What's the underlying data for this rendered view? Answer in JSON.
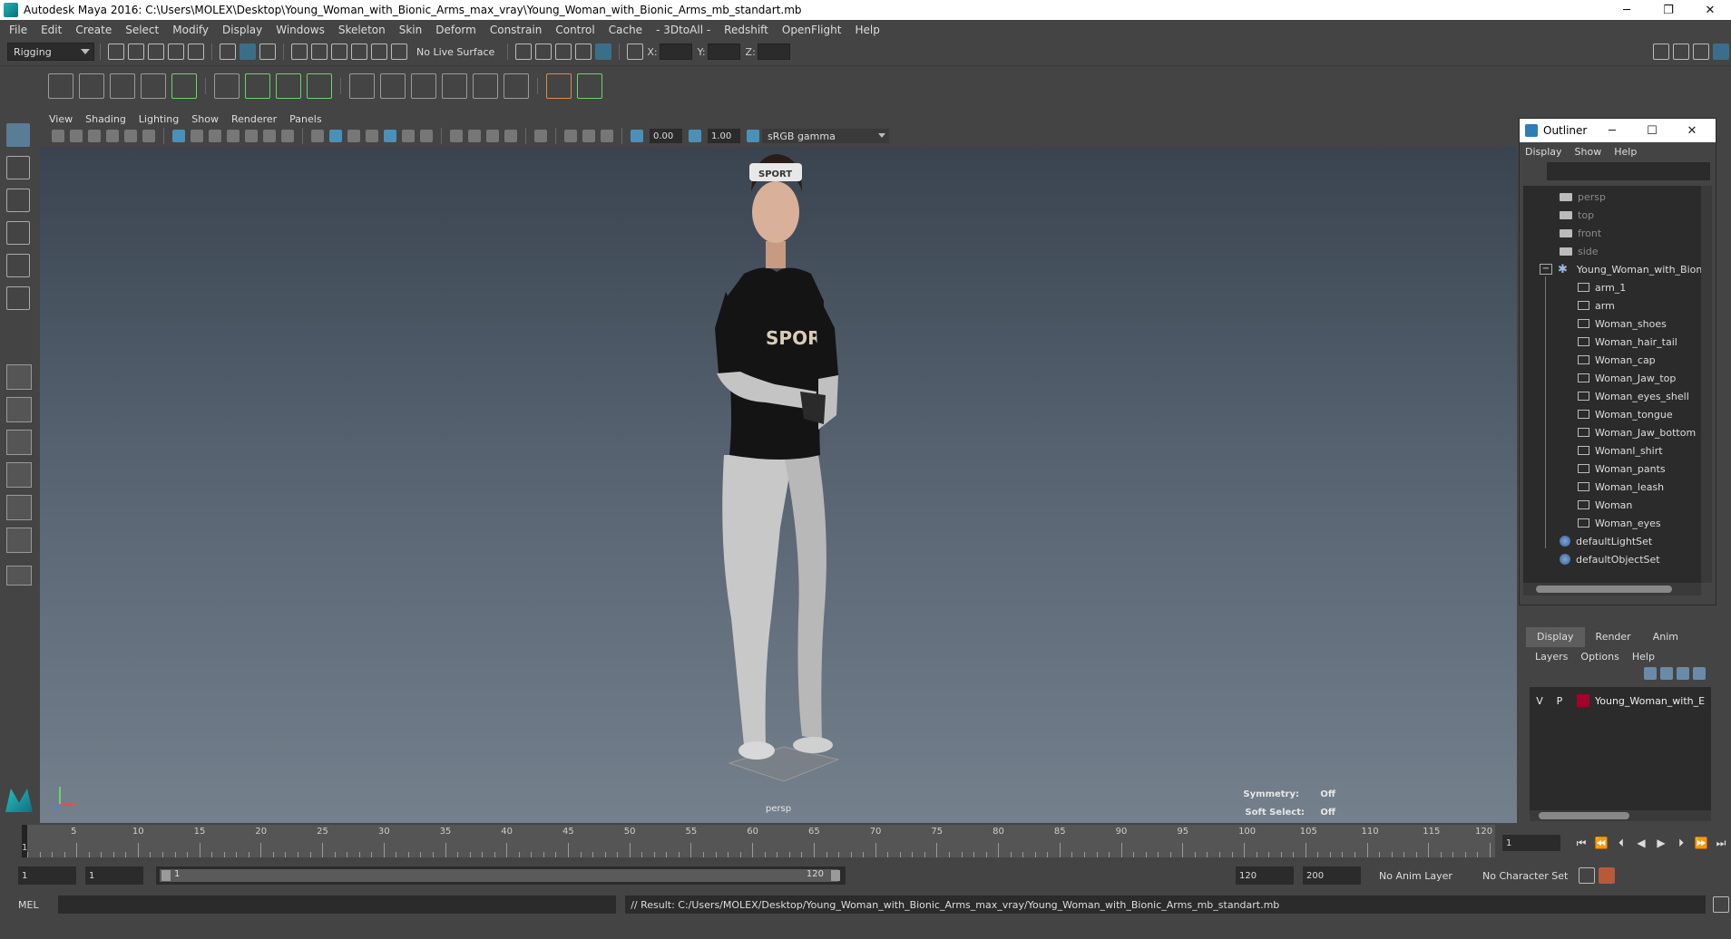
{
  "window": {
    "title": "Autodesk Maya 2016: C:\\Users\\MOLEX\\Desktop\\Young_Woman_with_Bionic_Arms_max_vray\\Young_Woman_with_Bionic_Arms_mb_standart.mb",
    "minimize": "─",
    "restore": "❐",
    "close": "✕"
  },
  "menubar": [
    "File",
    "Edit",
    "Create",
    "Select",
    "Modify",
    "Display",
    "Windows",
    "Skeleton",
    "Skin",
    "Deform",
    "Constrain",
    "Control",
    "Cache",
    "- 3DtoAll -",
    "Redshift",
    "OpenFlight",
    "Help"
  ],
  "statusline": {
    "menu_set": "Rigging",
    "live_surface": "No Live Surface",
    "x_label": "X:",
    "y_label": "Y:",
    "z_label": "Z:"
  },
  "viewport": {
    "menu": [
      "View",
      "Shading",
      "Lighting",
      "Show",
      "Renderer",
      "Panels"
    ],
    "field1": "0.00",
    "field2": "1.00",
    "colorspace": "sRGB gamma",
    "camera_label": "persp",
    "symmetry_label": "Symmetry:",
    "symmetry_value": "Off",
    "soft_select_label": "Soft Select:",
    "soft_select_value": "Off",
    "character_shirt_text": "SPORT",
    "character_cap_text": "SPORT"
  },
  "outliner": {
    "title": "Outliner",
    "menu": [
      "Display",
      "Show",
      "Help"
    ],
    "items": [
      {
        "label": "persp",
        "icon": "camera-icon",
        "dim": true
      },
      {
        "label": "top",
        "icon": "camera-icon",
        "dim": true
      },
      {
        "label": "front",
        "icon": "camera-icon",
        "dim": true
      },
      {
        "label": "side",
        "icon": "camera-icon",
        "dim": true
      },
      {
        "label": "Young_Woman_with_Bioni",
        "icon": "group-icon",
        "expanded": "−"
      },
      {
        "label": "arm_1",
        "icon": "mesh-icon"
      },
      {
        "label": "arm",
        "icon": "mesh-icon"
      },
      {
        "label": "Woman_shoes",
        "icon": "mesh-icon"
      },
      {
        "label": "Woman_hair_tail",
        "icon": "mesh-icon"
      },
      {
        "label": "Woman_cap",
        "icon": "mesh-icon"
      },
      {
        "label": "Woman_Jaw_top",
        "icon": "mesh-icon"
      },
      {
        "label": "Woman_eyes_shell",
        "icon": "mesh-icon"
      },
      {
        "label": "Woman_tongue",
        "icon": "mesh-icon"
      },
      {
        "label": "Woman_Jaw_bottom",
        "icon": "mesh-icon"
      },
      {
        "label": "Womanl_shirt",
        "icon": "mesh-icon"
      },
      {
        "label": "Woman_pants",
        "icon": "mesh-icon"
      },
      {
        "label": "Woman_leash",
        "icon": "mesh-icon"
      },
      {
        "label": "Woman",
        "icon": "mesh-icon"
      },
      {
        "label": "Woman_eyes",
        "icon": "mesh-icon"
      },
      {
        "label": "defaultLightSet",
        "icon": "set-icon"
      },
      {
        "label": "defaultObjectSet",
        "icon": "set-icon"
      }
    ]
  },
  "layer_editor": {
    "tabs": [
      "Display",
      "Render",
      "Anim"
    ],
    "active_tab": "Display",
    "menu": [
      "Layers",
      "Options",
      "Help"
    ],
    "layer": {
      "v": "V",
      "p": "P",
      "name": "Young_Woman_with_E",
      "color": "#a6002a"
    }
  },
  "timeslider": {
    "labels": [
      "5",
      "10",
      "15",
      "20",
      "25",
      "30",
      "35",
      "40",
      "45",
      "50",
      "55",
      "60",
      "65",
      "70",
      "75",
      "80",
      "85",
      "90",
      "95",
      "100",
      "105",
      "110",
      "115",
      "120"
    ],
    "current_frame_marker": "1",
    "current_frame": "1"
  },
  "range": {
    "start": "1",
    "playback_start": "1",
    "range_start_label": "1",
    "range_end_label": "120",
    "playback_end": "120",
    "end": "200",
    "anim_layer": "No Anim Layer",
    "character_set": "No Character Set"
  },
  "cmdline": {
    "mode": "MEL",
    "result": "// Result: C:/Users/MOLEX/Desktop/Young_Woman_with_Bionic_Arms_max_vray/Young_Woman_with_Bionic_Arms_mb_standart.mb"
  }
}
